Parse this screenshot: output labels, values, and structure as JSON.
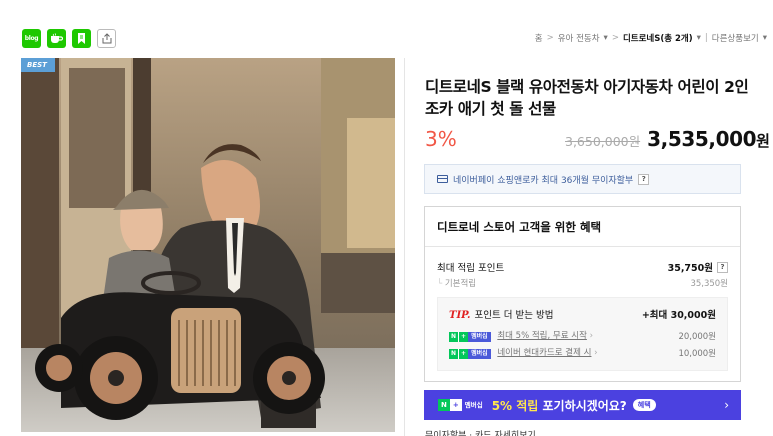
{
  "share": {
    "blog_label": "blog"
  },
  "breadcrumb": {
    "home": "홈",
    "cat": "유아 전동차",
    "cur": "디트로네S(총 2개)",
    "other": "다른상품보기"
  },
  "photo": {
    "badge": "BEST"
  },
  "product": {
    "title": "디트로네S 블랙 유아전동차 아기자동차 어린이 2인 조카 애기 첫 돌 선물",
    "discount": "3%",
    "original_price": "3,650,000원",
    "price": "3,535,000",
    "price_unit": "원"
  },
  "npay": {
    "text": "네이버페이 쇼핑앤로카 최대 36개월 무이자할부",
    "help": "?"
  },
  "benefit": {
    "title": "디트로네 스토어 고객을 위한 혜택",
    "max_points_label": "최대 적립 포인트",
    "max_points_value": "35,750원",
    "help": "?",
    "base_label": "기본적립",
    "base_value": "35,350원",
    "tip_label": "TIP.",
    "tip_text": "포인트 더 받는 방법",
    "tip_max": "+최대 30,000원",
    "badge_n": "N",
    "badge_plus": "+",
    "badge_membership": "멤버십",
    "tip_rows": [
      {
        "text": "최대 5% 적립, 무료 시작",
        "amount": "20,000원"
      },
      {
        "text": "네이버 현대카드로 결제 시",
        "amount": "10,000원"
      }
    ]
  },
  "banner": {
    "badge_n": "N",
    "badge_plus": "+",
    "badge_membership": "멤버십",
    "highlight": "5% 적립",
    "text": " 포기하시겠어요?",
    "pill": "혜택",
    "chevron": "›"
  },
  "footer": {
    "cutoff": "무이자할부 · 카드 자세히보기"
  },
  "colors": {
    "discount": "#f15746",
    "naver_green": "#03c75a",
    "banner": "#4b41e0"
  }
}
